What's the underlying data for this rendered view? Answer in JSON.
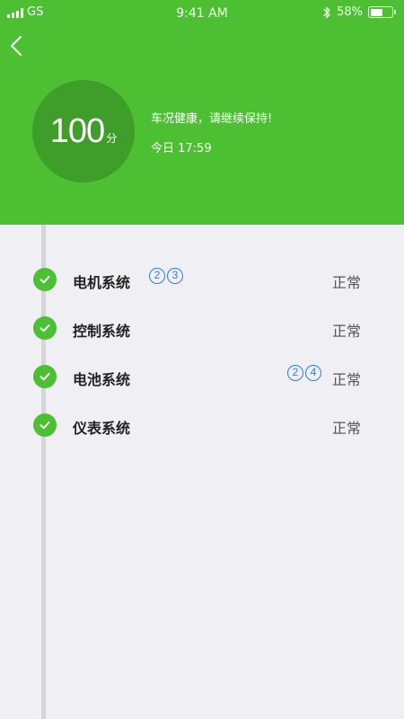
{
  "status_bar": {
    "carrier": "GS",
    "time": "9:41 AM",
    "battery_percent": "58%",
    "battery_level": 0.58,
    "signal_bars": 4
  },
  "header": {
    "score": "100",
    "score_unit": "分",
    "message": "车况健康，请继续保持!",
    "check_time": "今日 17:59",
    "background_color": "#4cbf33",
    "circle_color": "#3f9e2a"
  },
  "systems": [
    {
      "label": "电机系统",
      "status": "正常",
      "badges": [
        "2",
        "3"
      ]
    },
    {
      "label": "控制系统",
      "status": "正常",
      "badges": []
    },
    {
      "label": "电池系统",
      "status": "正常",
      "badges": [
        "2",
        "4"
      ]
    },
    {
      "label": "仪表系统",
      "status": "正常",
      "badges": []
    }
  ],
  "icons": {
    "back": "chevron-left-icon",
    "check": "check-circle-icon",
    "bluetooth": "bluetooth-icon",
    "battery": "battery-icon",
    "signal": "signal-icon"
  },
  "colors": {
    "accent": "#4cbf33",
    "badge": "#2a7fdc",
    "page_background": "#f0eff4"
  }
}
